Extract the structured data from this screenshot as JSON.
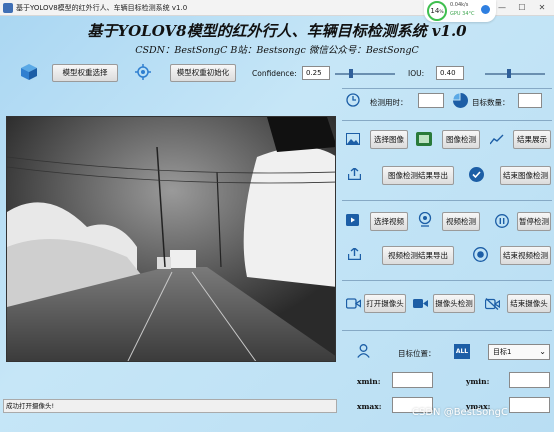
{
  "window": {
    "title": "基于YOLOV8模型的红外行人、车辆目标检测系统 v1.0",
    "controls": {
      "minimize": "—",
      "maximize": "☐",
      "close": "✕"
    }
  },
  "perf_overlay": {
    "percent": "14",
    "percent_unit": "%",
    "net": "0.04k/s",
    "gpu": "GPU 34°C"
  },
  "header": {
    "title": "基于YOLOV8模型的红外行人、车辆目标检测系统 v1.0",
    "subtitle": "CSDN：BestSongC   B站：Bestsongc   微信公众号：BestSongC"
  },
  "toolbar": {
    "model_select_label": "模型权重选择",
    "model_init_label": "模型权重初始化",
    "confidence_label": "Confidence:",
    "confidence_value": "0.25",
    "confidence_level": 0.25,
    "iou_label": "IOU:",
    "iou_value": "0.40",
    "iou_level": 0.4
  },
  "stats": {
    "time_label": "检测用时：",
    "time_value": "",
    "count_label": "目标数量：",
    "count_value": ""
  },
  "image_section": {
    "select_label": "选择图像",
    "detect_label": "图像检测",
    "show_label": "结果展示",
    "export_label": "图像检测结果导出",
    "end_label": "结束图像检测"
  },
  "video_section": {
    "select_label": "选择视频",
    "detect_label": "视频检测",
    "pause_label": "暂停检测",
    "export_label": "视频检测结果导出",
    "end_label": "结束视频检测"
  },
  "camera_section": {
    "open_label": "打开摄像头",
    "detect_label": "摄像头检测",
    "close_label": "结束摄像头"
  },
  "target_section": {
    "position_label": "目标位置：",
    "all_badge": "ALL",
    "select_value": "目标1",
    "xmin_label": "xmin:",
    "ymin_label": "ymin:",
    "xmax_label": "xmax:",
    "ymax_label": "ymax:"
  },
  "status": {
    "message": "成功打开摄像头!"
  },
  "watermark": "CSDN @BestSongC",
  "colors": {
    "accent": "#2f7fe0",
    "panel_line": "#86a9c5",
    "ok_green": "#3fbf4f"
  }
}
